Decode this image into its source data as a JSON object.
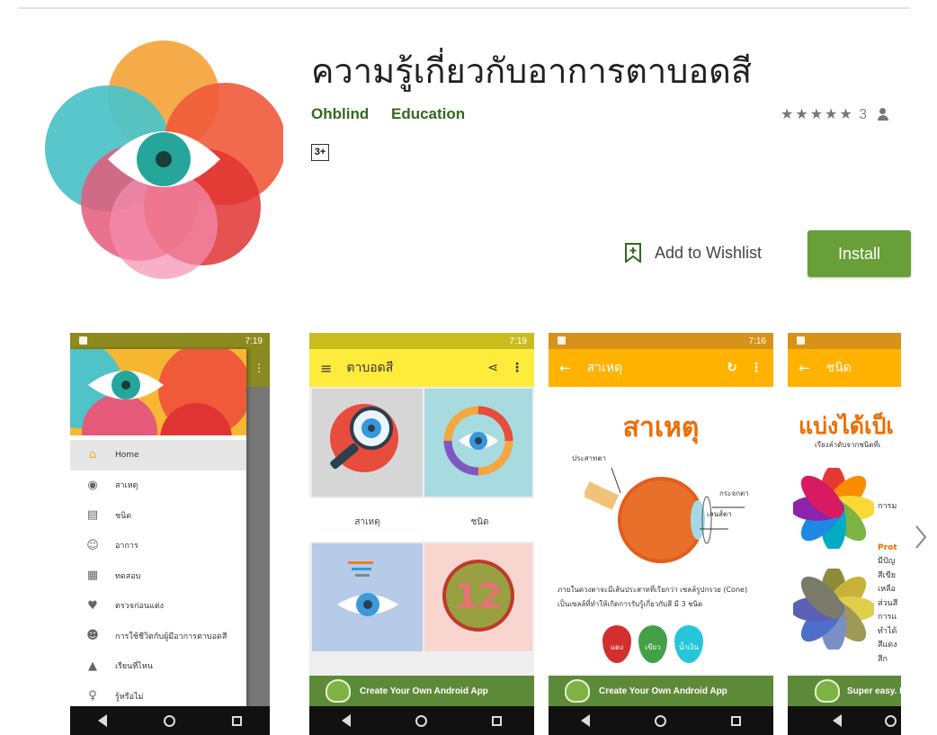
{
  "app": {
    "title": "ความรู้เกี่ยวกับอาการตาบอดสี",
    "developer": "Ohblind",
    "category": "Education",
    "stars": "★★★★★",
    "rating_count": "3",
    "content_rating": "3+",
    "wishlist_label": "Add to Wishlist",
    "install_label": "Install"
  },
  "screenshots": {
    "shot1": {
      "status_time": "7:19",
      "drawer_items": [
        {
          "icon": "home-icon",
          "label": "Home"
        },
        {
          "icon": "eye-icon",
          "label": "สาเหตุ"
        },
        {
          "icon": "document-icon",
          "label": "ชนิด"
        },
        {
          "icon": "face-icon",
          "label": "อาการ"
        },
        {
          "icon": "test-icon",
          "label": "ทดสอบ"
        },
        {
          "icon": "heart-icon",
          "label": "ตรวจก่อนแต่ง"
        },
        {
          "icon": "smile-icon",
          "label": "การใช้ชีวิตกับผู้มีอาการตาบอดสี"
        },
        {
          "icon": "graduation-icon",
          "label": "เรียนที่ไหน"
        },
        {
          "icon": "bulb-icon",
          "label": "รู้หรือไม่"
        }
      ]
    },
    "shot2": {
      "status_time": "7:19",
      "appbar_title": "ตาบอดสี",
      "tile_labels": [
        "สาเหตุ",
        "ชนิด"
      ],
      "banner_text": "Create Your Own Android App"
    },
    "shot3": {
      "status_time": "7:16",
      "appbar_title": "สาเหตุ",
      "heading": "สาเหตุ",
      "label_nerve": "ประสาทตา",
      "label_cornea": "กระจกตา",
      "label_lens": "เลนส์ตา",
      "body_line1": "ภายในดวงตาจะมีเส้นประสาทที่เรียกว่า เซลล์รูปกรวย (Cone)",
      "body_line2": "เป็นเซลล์ที่ทำให้เกิดการรับรู้เกี่ยวกับสี มี 3 ชนิด",
      "drops": [
        "แดง",
        "เขียว",
        "น้ำเงิน"
      ],
      "banner_text": "Create Your Own Android App"
    },
    "shot4": {
      "appbar_title": "ชนิด",
      "heading": "แบ่งได้เป็เ",
      "subheading": "เรียงลำดับจากชนิดที่เ",
      "text_top": "การม",
      "text_lines": [
        "Prot",
        "มีปัญ",
        "สีเขีย",
        "เหลือ",
        "ส่วนสี",
        "การแ",
        "ทำได้",
        "สีแดง",
        "สีก"
      ],
      "banner_text": "Super easy. N"
    }
  },
  "colors": {
    "brand_green": "#33691e",
    "install_green": "#689f38",
    "appbar_yellow": "#ffeb3b",
    "appbar_orange": "#ffb300"
  }
}
